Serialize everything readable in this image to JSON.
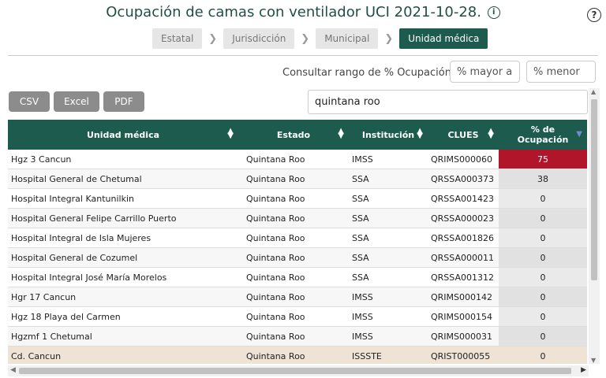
{
  "title": "Ocupación de camas con ventilador UCI 2021-10-28.",
  "help_symbol": "?",
  "info_symbol": "i",
  "breadcrumbs": [
    "Estatal",
    "Jurisdicción",
    "Municipal",
    "Unidad médica"
  ],
  "range": {
    "label": "Consultar rango de % Ocupación:",
    "min_placeholder": "% mayor a",
    "max_placeholder": "% menor a"
  },
  "export": {
    "csv": "CSV",
    "excel": "Excel",
    "pdf": "PDF"
  },
  "search": {
    "value": "quintana roo"
  },
  "table": {
    "headers": {
      "unidad": "Unidad médica",
      "estado": "Estado",
      "institucion": "Institución",
      "clues": "CLUES",
      "ocupacion_1": "% de",
      "ocupacion_2": "Ocupación"
    },
    "rows": [
      {
        "unidad": "Hgz 3 Cancun",
        "estado": "Quintana Roo",
        "institucion": "IMSS",
        "clues": "QRIMS000060",
        "ocupacion": "75"
      },
      {
        "unidad": "Hospital General de Chetumal",
        "estado": "Quintana Roo",
        "institucion": "SSA",
        "clues": "QRSSA000373",
        "ocupacion": "38"
      },
      {
        "unidad": "Hospital Integral Kantunilkin",
        "estado": "Quintana Roo",
        "institucion": "SSA",
        "clues": "QRSSA001423",
        "ocupacion": "0"
      },
      {
        "unidad": "Hospital General Felipe Carrillo Puerto",
        "estado": "Quintana Roo",
        "institucion": "SSA",
        "clues": "QRSSA000023",
        "ocupacion": "0"
      },
      {
        "unidad": "Hospital Integral de Isla Mujeres",
        "estado": "Quintana Roo",
        "institucion": "SSA",
        "clues": "QRSSA001826",
        "ocupacion": "0"
      },
      {
        "unidad": "Hospital General de Cozumel",
        "estado": "Quintana Roo",
        "institucion": "SSA",
        "clues": "QRSSA000011",
        "ocupacion": "0"
      },
      {
        "unidad": "Hospital Integral José María Morelos",
        "estado": "Quintana Roo",
        "institucion": "SSA",
        "clues": "QRSSA001312",
        "ocupacion": "0"
      },
      {
        "unidad": "Hgr 17 Cancun",
        "estado": "Quintana Roo",
        "institucion": "IMSS",
        "clues": "QRIMS000142",
        "ocupacion": "0"
      },
      {
        "unidad": "Hgz 18 Playa del Carmen",
        "estado": "Quintana Roo",
        "institucion": "IMSS",
        "clues": "QRIMS000154",
        "ocupacion": "0"
      },
      {
        "unidad": "Hgzmf 1 Chetumal",
        "estado": "Quintana Roo",
        "institucion": "IMSS",
        "clues": "QRIMS000031",
        "ocupacion": "0"
      },
      {
        "unidad": "Cd. Cancun",
        "estado": "Quintana Roo",
        "institucion": "ISSSTE",
        "clues": "QRIST000055",
        "ocupacion": "0"
      }
    ]
  },
  "colors": {
    "header": "#1e5b4f",
    "alert": "#b0152a",
    "highlight": "#eee3d5"
  }
}
